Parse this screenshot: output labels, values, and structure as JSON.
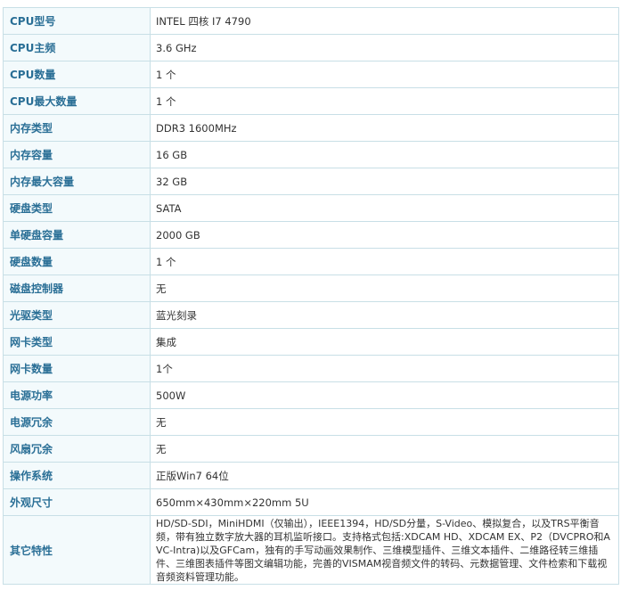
{
  "specs": [
    {
      "label": "CPU型号",
      "value": "INTEL 四核 I7 4790"
    },
    {
      "label": "CPU主频",
      "value": "3.6  GHz"
    },
    {
      "label": "CPU数量",
      "value": "1  个"
    },
    {
      "label": "CPU最大数量",
      "value": "1  个"
    },
    {
      "label": "内存类型",
      "value": "DDR3 1600MHz"
    },
    {
      "label": "内存容量",
      "value": "16  GB"
    },
    {
      "label": "内存最大容量",
      "value": "32  GB"
    },
    {
      "label": "硬盘类型",
      "value": "SATA"
    },
    {
      "label": "单硬盘容量",
      "value": "2000  GB"
    },
    {
      "label": "硬盘数量",
      "value": "1  个"
    },
    {
      "label": "磁盘控制器",
      "value": "无"
    },
    {
      "label": "光驱类型",
      "value": "蓝光刻录"
    },
    {
      "label": "网卡类型",
      "value": "集成"
    },
    {
      "label": "网卡数量",
      "value": "1个"
    },
    {
      "label": "电源功率",
      "value": "500W"
    },
    {
      "label": "电源冗余",
      "value": "无"
    },
    {
      "label": "风扇冗余",
      "value": "无"
    },
    {
      "label": "操作系统",
      "value": "正版Win7 64位"
    },
    {
      "label": "外观尺寸",
      "value": "650mm×430mm×220mm 5U"
    },
    {
      "label": "其它特性",
      "value": "HD/SD-SDI，MiniHDMI（仅输出），IEEE1394，HD/SD分量，S-Video、模拟复合，以及TRS平衡音频，带有独立数字放大器的耳机监听接口。支持格式包括:XDCAM HD、XDCAM EX、P2（DVCPRO和AVC-Intra)以及GFCam，独有的手写动画效果制作、三维模型插件、三维文本插件、二维路径转三维插件、三维图表插件等图文编辑功能，完善的VISMAM视音频文件的转码、元数据管理、文件检索和下载视音频资料管理功能。"
    }
  ]
}
